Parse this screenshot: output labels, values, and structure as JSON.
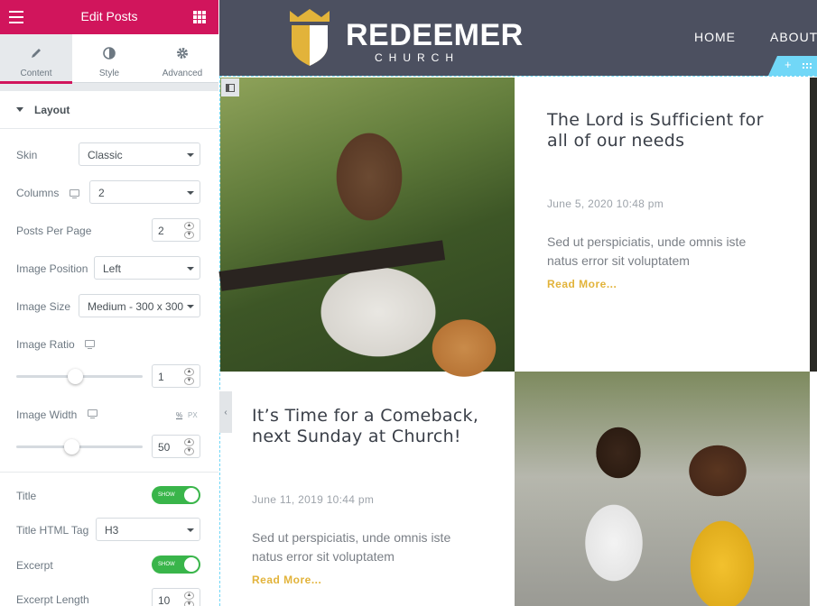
{
  "panel": {
    "title": "Edit Posts",
    "tabs": [
      {
        "label": "Content",
        "active": true
      },
      {
        "label": "Style"
      },
      {
        "label": "Advanced"
      }
    ],
    "section_title": "Layout",
    "controls": {
      "skin": {
        "label": "Skin",
        "value": "Classic"
      },
      "columns": {
        "label": "Columns",
        "value": "2"
      },
      "posts_per_page": {
        "label": "Posts Per Page",
        "value": "2"
      },
      "image_position": {
        "label": "Image Position",
        "value": "Left"
      },
      "image_size": {
        "label": "Image Size",
        "value": "Medium - 300 x 300"
      },
      "image_ratio": {
        "label": "Image Ratio",
        "value": "1",
        "slider_fraction": 0.47
      },
      "image_width": {
        "label": "Image Width",
        "value": "50",
        "unit_pct": "%",
        "unit_px": "PX",
        "slider_fraction": 0.44
      },
      "title": {
        "label": "Title",
        "toggle": "SHOW"
      },
      "title_tag": {
        "label": "Title HTML Tag",
        "value": "H3"
      },
      "excerpt": {
        "label": "Excerpt",
        "toggle": "SHOW"
      },
      "excerpt_length": {
        "label": "Excerpt Length",
        "value": "10"
      }
    },
    "accent": "#d1155c",
    "toggle_color": "#39b54a"
  },
  "site": {
    "brand": "REDEEMER",
    "tagline": "CHURCH",
    "nav": [
      "HOME",
      "ABOUT"
    ],
    "header_color": "#4c5060",
    "accent": "#e2b33a"
  },
  "posts": [
    {
      "title": "The Lord is Sufficient for all of our needs",
      "date": "June 5, 2020 10:48 pm",
      "excerpt": "Sed ut perspiciatis, unde omnis iste natus error sit voluptatem",
      "read_more": "Read More..."
    },
    {
      "title": "It’s Time for a Comeback, next Sunday at Church!",
      "date": "June 11, 2019 10:44 pm",
      "excerpt": "Sed ut perspiciatis, unde omnis iste natus error sit voluptatem",
      "read_more": "Read More..."
    }
  ]
}
